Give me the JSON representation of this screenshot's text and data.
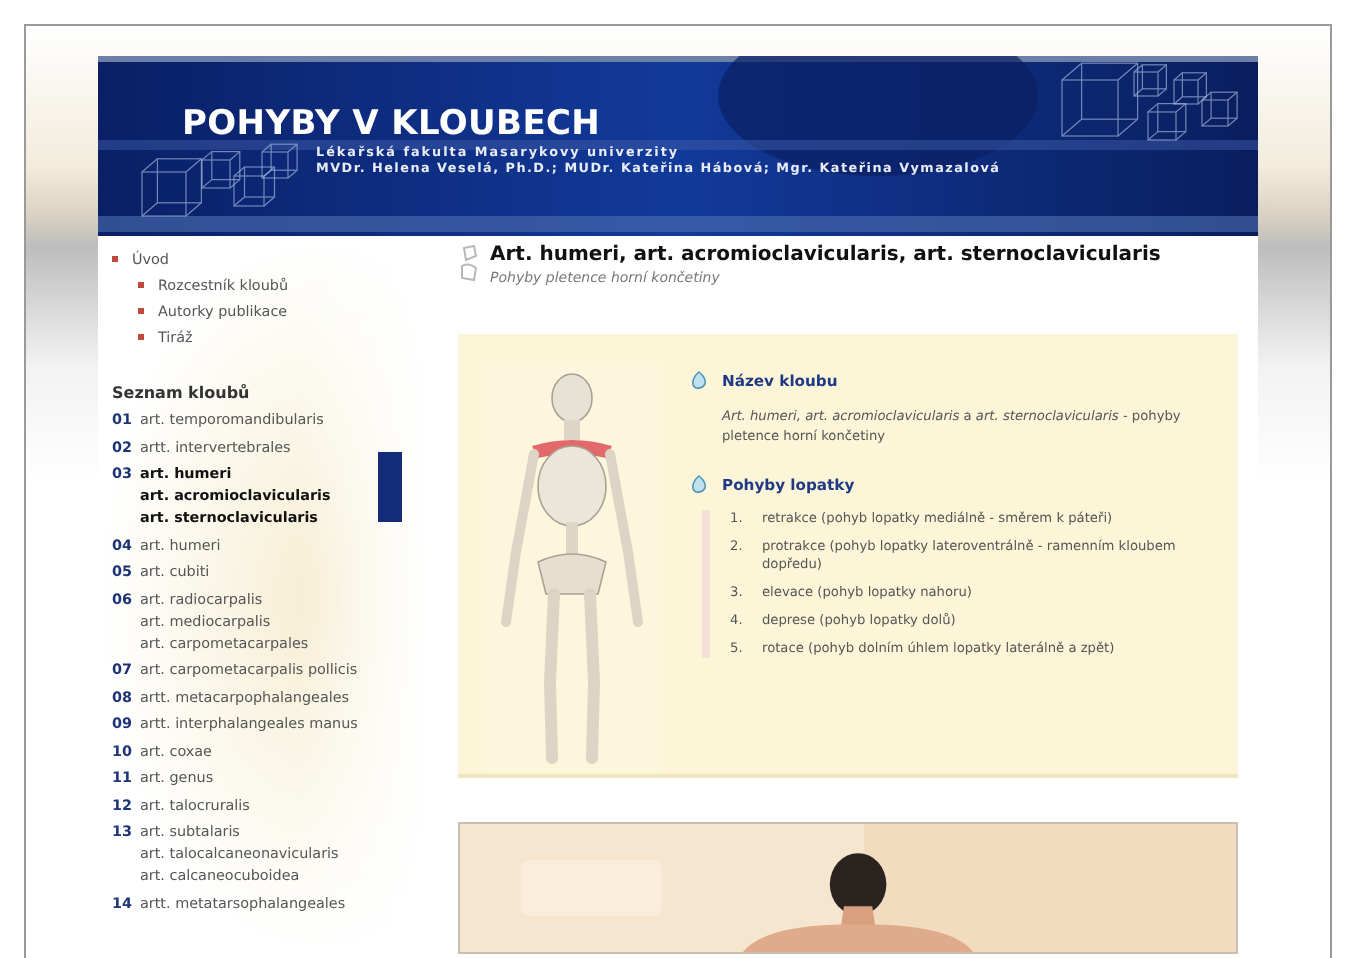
{
  "header": {
    "title": "POHYBY V KLOUBECH",
    "subtitle": "Lékařská fakulta Masarykovy univerzity",
    "authors": "MVDr. Helena Veselá, Ph.D.; MUDr. Kateřina Hábová; Mgr. Kateřina Vymazalová"
  },
  "sidebar": {
    "menu": [
      {
        "label": "Úvod",
        "children": [
          {
            "label": "Rozcestník kloubů"
          },
          {
            "label": "Autorky publikace"
          },
          {
            "label": "Tiráž"
          }
        ]
      }
    ],
    "list_title": "Seznam kloubů",
    "joints": [
      {
        "number": "01",
        "names": [
          "art. temporomandibularis"
        ],
        "selected": false
      },
      {
        "number": "02",
        "names": [
          "artt. intervertebrales"
        ],
        "selected": false
      },
      {
        "number": "03",
        "names": [
          "art. humeri",
          "art. acromioclavicularis",
          "art. sternoclavicularis"
        ],
        "selected": true
      },
      {
        "number": "04",
        "names": [
          "art. humeri"
        ],
        "selected": false
      },
      {
        "number": "05",
        "names": [
          "art. cubiti"
        ],
        "selected": false
      },
      {
        "number": "06",
        "names": [
          "art. radiocarpalis",
          "art. mediocarpalis",
          "art. carpometacarpales"
        ],
        "selected": false
      },
      {
        "number": "07",
        "names": [
          "art. carpometacarpalis pollicis"
        ],
        "selected": false
      },
      {
        "number": "08",
        "names": [
          "artt. metacarpophalangeales"
        ],
        "selected": false
      },
      {
        "number": "09",
        "names": [
          "artt. interphalangeales manus"
        ],
        "selected": false
      },
      {
        "number": "10",
        "names": [
          "art. coxae"
        ],
        "selected": false
      },
      {
        "number": "11",
        "names": [
          "art. genus"
        ],
        "selected": false
      },
      {
        "number": "12",
        "names": [
          "art. talocruralis"
        ],
        "selected": false
      },
      {
        "number": "13",
        "names": [
          "art. subtalaris",
          "art. talocalcaneonavicularis",
          "art. calcaneocuboidea"
        ],
        "selected": false
      },
      {
        "number": "14",
        "names": [
          "artt. metatarsophalangeales"
        ],
        "selected": false
      }
    ]
  },
  "article": {
    "title": "Art. humeri, art. acromioclavicularis, art. sternoclavicularis",
    "subtitle": "Pohyby pletence horní končetiny",
    "sections": [
      {
        "heading": "Název kloubu",
        "kind": "text",
        "text": "*Art. humeri, art. acromioclavicularis* a *art. sternoclavicularis* - pohyby pletence horní končetiny"
      },
      {
        "heading": "Pohyby lopatky",
        "kind": "list",
        "items": [
          {
            "number": "1.",
            "text": "retrakce (pohyb lopatky mediálně - směrem k páteři)"
          },
          {
            "number": "2.",
            "text": "protrakce (pohyb lopatky lateroventrálně - ramenním kloubem dopředu)"
          },
          {
            "number": "3.",
            "text": "elevace (pohyb lopatky nahoru)"
          },
          {
            "number": "4.",
            "text": "deprese (pohyb lopatky dolů)"
          },
          {
            "number": "5.",
            "text": "rotace (pohyb dolním úhlem lopatky laterálně a zpět)"
          }
        ]
      }
    ]
  }
}
